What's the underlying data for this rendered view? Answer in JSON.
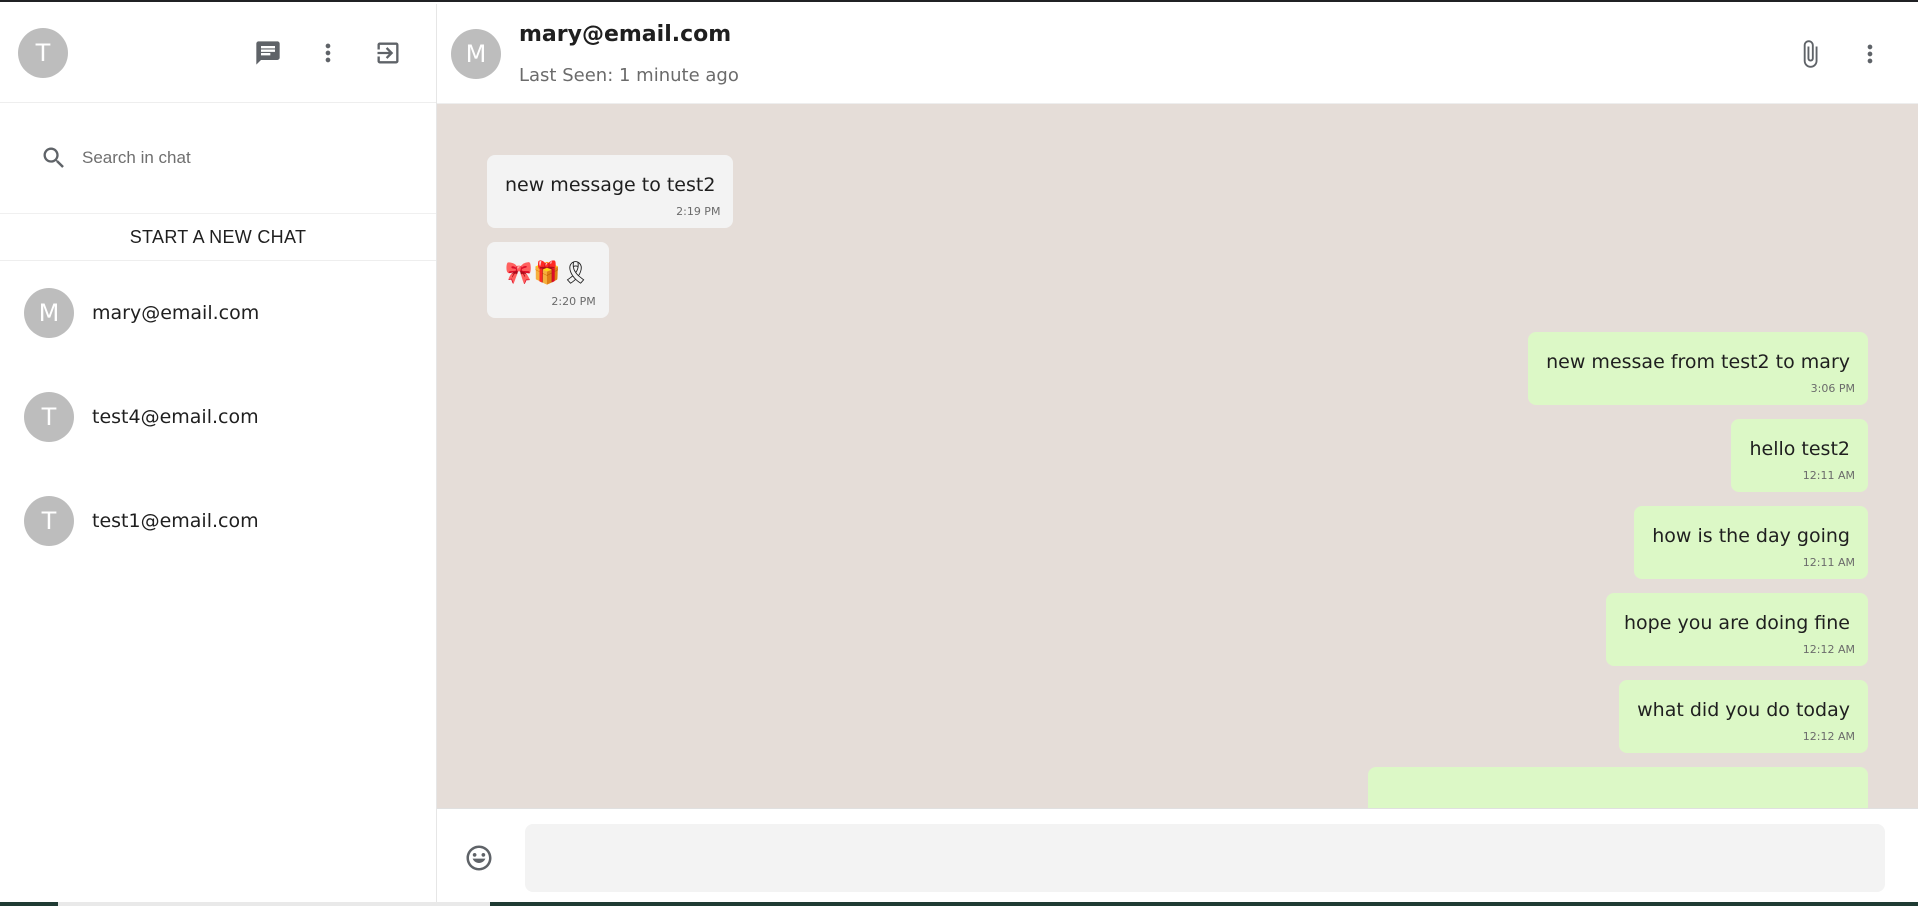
{
  "user": {
    "avatar_initial": "T"
  },
  "sidebar": {
    "icons": [
      "chat-icon",
      "more-vert-icon",
      "logout-icon"
    ],
    "search": {
      "placeholder": "Search in chat",
      "value": ""
    },
    "new_chat_label": "START A NEW CHAT",
    "chats": [
      {
        "initial": "M",
        "name": "mary@email.com"
      },
      {
        "initial": "T",
        "name": "test4@email.com"
      },
      {
        "initial": "T",
        "name": "test1@email.com"
      }
    ]
  },
  "header": {
    "avatar_initial": "M",
    "contact_name": "mary@email.com",
    "last_seen": "Last Seen: 1 minute ago",
    "icons": [
      "attach-icon",
      "more-vert-icon"
    ]
  },
  "messages": [
    {
      "direction": "in",
      "text": "new message to test2",
      "time": "2:19 PM"
    },
    {
      "direction": "in",
      "text": "🎀🎁🎗",
      "time": "2:20 PM",
      "emoji": true
    },
    {
      "direction": "out",
      "text": "new messae from test2 to mary",
      "time": "3:06 PM"
    },
    {
      "direction": "out",
      "text": "hello test2",
      "time": "12:11 AM"
    },
    {
      "direction": "out",
      "text": "how is the day going",
      "time": "12:11 AM"
    },
    {
      "direction": "out",
      "text": "hope you are doing fine",
      "time": "12:12 AM"
    },
    {
      "direction": "out",
      "text": "what did you do today",
      "time": "12:12 AM"
    },
    {
      "direction": "out",
      "text": "",
      "time": ""
    }
  ],
  "composer": {
    "placeholder": "",
    "value": ""
  },
  "colors": {
    "chat_background": "#e5ddd8",
    "incoming_bubble": "#f3f3f3",
    "outgoing_bubble": "#dcf8c6",
    "avatar": "#bdbdbd"
  }
}
